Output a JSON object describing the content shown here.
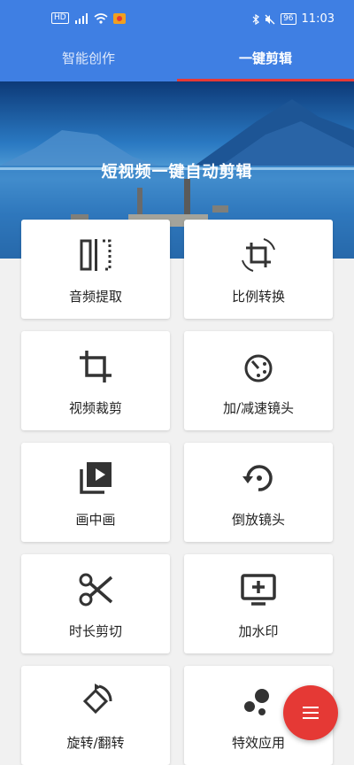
{
  "status": {
    "left_icons": [
      "hd-badge",
      "signal-icon",
      "wifi-icon",
      "notification-icon"
    ],
    "hd": "HD",
    "battery": "96",
    "time": "11:03"
  },
  "tabs": [
    {
      "label": "智能创作",
      "active": false
    },
    {
      "label": "一键剪辑",
      "active": true
    }
  ],
  "banner": {
    "title": "短视频一键自动剪辑"
  },
  "tools": [
    {
      "label": "音频提取",
      "icon": "audio-extract-icon"
    },
    {
      "label": "比例转换",
      "icon": "ratio-convert-icon"
    },
    {
      "label": "视频裁剪",
      "icon": "crop-icon"
    },
    {
      "label": "加/减速镜头",
      "icon": "speed-icon"
    },
    {
      "label": "画中画",
      "icon": "picture-in-picture-icon"
    },
    {
      "label": "倒放镜头",
      "icon": "reverse-icon"
    },
    {
      "label": "时长剪切",
      "icon": "scissors-icon"
    },
    {
      "label": "加水印",
      "icon": "watermark-icon"
    },
    {
      "label": "旋转/翻转",
      "icon": "rotate-icon"
    },
    {
      "label": "特效应用",
      "icon": "effects-icon"
    }
  ],
  "fab": {
    "icon": "menu-icon"
  },
  "colors": {
    "primary": "#3f7fe3",
    "accent": "#e53935",
    "icon": "#333333"
  }
}
